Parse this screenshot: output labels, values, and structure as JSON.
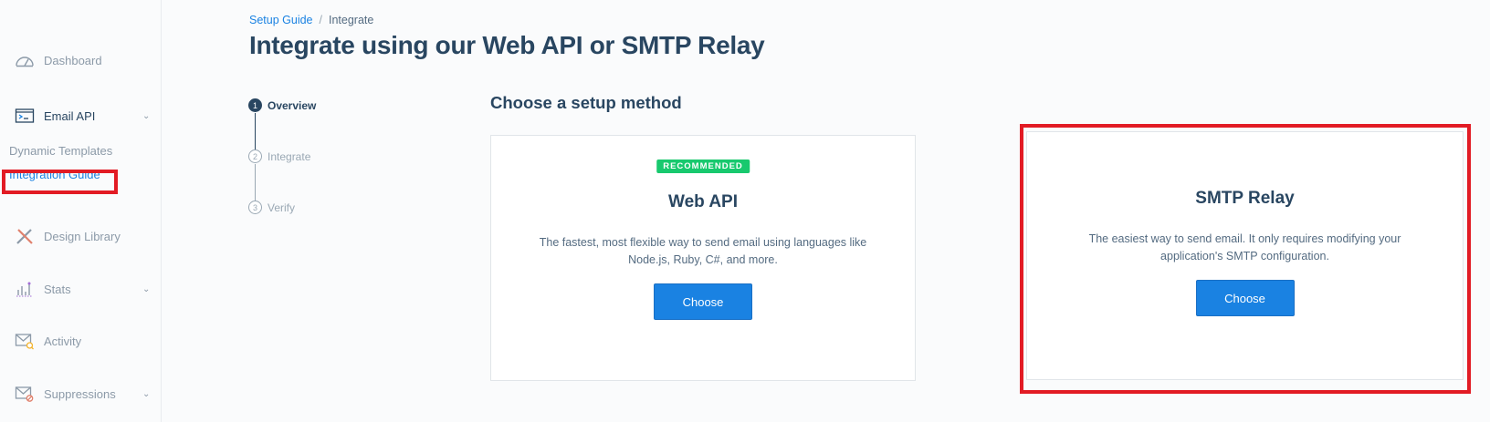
{
  "sidebar": {
    "items": [
      {
        "label": "Dashboard",
        "icon": "gauge-icon",
        "has_chevron": false
      },
      {
        "label": "Email API",
        "icon": "terminal-icon",
        "has_chevron": true
      },
      {
        "label": "Design Library",
        "icon": "pencil-ruler-icon",
        "has_chevron": false
      },
      {
        "label": "Stats",
        "icon": "bar-chart-icon",
        "has_chevron": true
      },
      {
        "label": "Activity",
        "icon": "envelope-search-icon",
        "has_chevron": false
      },
      {
        "label": "Suppressions",
        "icon": "envelope-blocked-icon",
        "has_chevron": true
      }
    ],
    "sub_items": [
      {
        "label": "Dynamic Templates"
      },
      {
        "label": "Integration Guide"
      }
    ]
  },
  "breadcrumb": {
    "parent": "Setup Guide",
    "separator": "/",
    "current": "Integrate"
  },
  "page_title": "Integrate using our Web API or SMTP Relay",
  "steps": [
    {
      "number": "1",
      "label": "Overview",
      "state": "active"
    },
    {
      "number": "2",
      "label": "Integrate",
      "state": "pending"
    },
    {
      "number": "3",
      "label": "Verify",
      "state": "pending"
    }
  ],
  "setup": {
    "title": "Choose a setup method",
    "methods": [
      {
        "badge": "RECOMMENDED",
        "title": "Web API",
        "description": "The fastest, most flexible way to send email using languages like Node.js, Ruby, C#, and more.",
        "button": "Choose"
      },
      {
        "title": "SMTP Relay",
        "description": "The easiest way to send email. It only requires modifying your application's SMTP configuration.",
        "button": "Choose"
      }
    ]
  },
  "colors": {
    "accent": "#1a82e2",
    "heading": "#294661",
    "badge": "#18c96e",
    "highlight": "#e21b24"
  }
}
